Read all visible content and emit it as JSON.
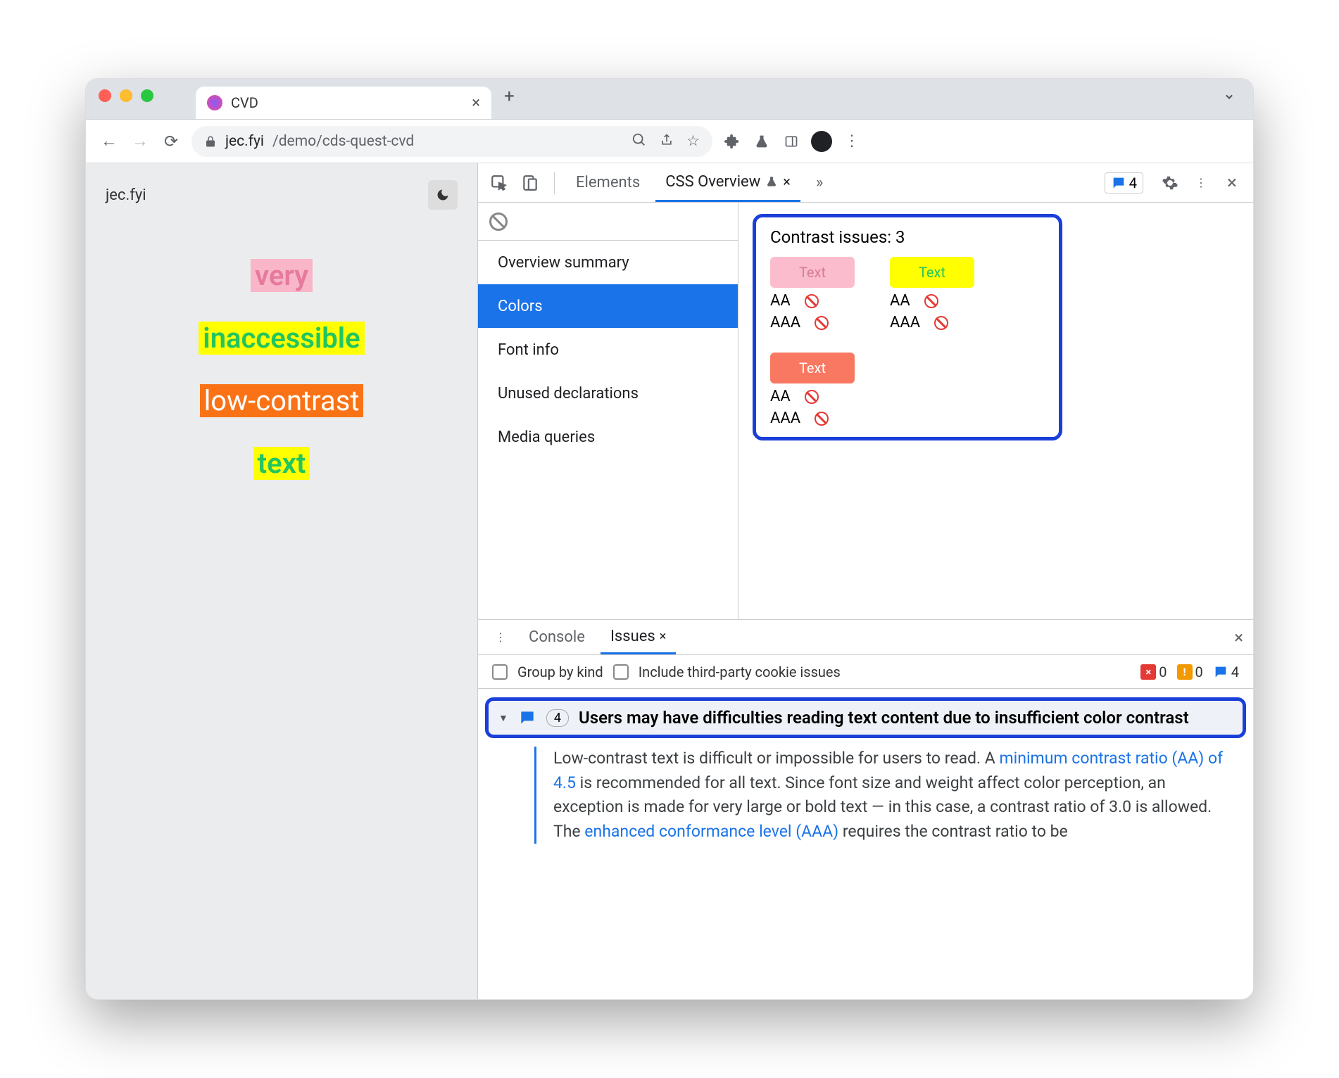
{
  "browser": {
    "tab_title": "CVD",
    "url_host": "jec.fyi",
    "url_path": "/demo/cds-quest-cvd"
  },
  "page": {
    "site_title": "jec.fyi",
    "samples": [
      "very",
      "inaccessible",
      "low-contrast",
      "text"
    ]
  },
  "devtools": {
    "tabs": {
      "elements": "Elements",
      "css_overview": "CSS Overview"
    },
    "issues_count": "4",
    "sidebar": {
      "items": [
        "Overview summary",
        "Colors",
        "Font info",
        "Unused declarations",
        "Media queries"
      ],
      "selected": 1
    },
    "contrast": {
      "title": "Contrast issues: 3",
      "swatches": [
        {
          "label": "Text",
          "aa": "AA",
          "aaa": "AAA"
        },
        {
          "label": "Text",
          "aa": "AA",
          "aaa": "AAA"
        },
        {
          "label": "Text",
          "aa": "AA",
          "aaa": "AAA"
        }
      ]
    }
  },
  "drawer": {
    "tabs": {
      "console": "Console",
      "issues": "Issues"
    },
    "filters": {
      "group": "Group by kind",
      "third_party": "Include third-party cookie issues"
    },
    "counts": {
      "errors": "0",
      "warnings": "0",
      "info": "4"
    },
    "issue": {
      "count": "4",
      "title": "Users may have difficulties reading text content due to insufficient color contrast",
      "body_pre": "Low-contrast text is difficult or impossible for users to read. A ",
      "link1": "minimum contrast ratio (AA) of 4.5",
      "body_mid": " is recommended for all text. Since font size and weight affect color perception, an exception is made for very large or bold text — in this case, a contrast ratio of 3.0 is allowed. The ",
      "link2": "enhanced conformance level (AAA)",
      "body_post": " requires the contrast ratio to be"
    }
  }
}
